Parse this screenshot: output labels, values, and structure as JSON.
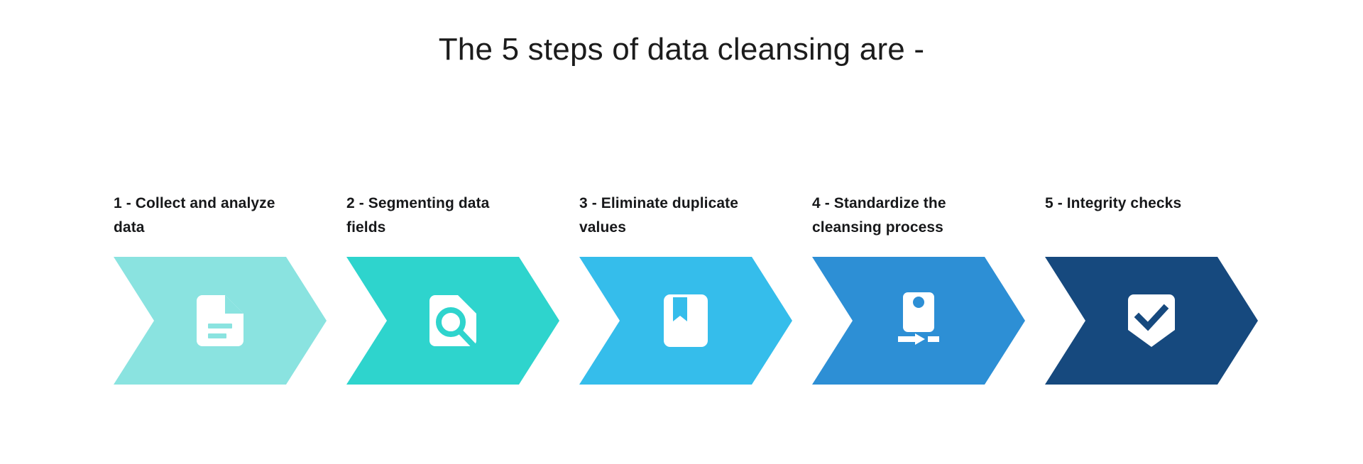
{
  "header": {
    "title": "The 5 steps of data cleansing are -"
  },
  "colors": {
    "background": "#ffffff",
    "title_text": "#1c1c1c",
    "label_text": "#17181a",
    "icon_fill": "#ffffff",
    "step1": "#8ae3e0",
    "step2": "#2ed4cd",
    "step3": "#35bdeb",
    "step4": "#2d8fd5",
    "step5": "#16497e"
  },
  "steps": [
    {
      "number": "1",
      "label": "1 - Collect and analyze data",
      "color": "#8ae3e0",
      "icon": "document-icon"
    },
    {
      "number": "2",
      "label": "2 - Segmenting data fields",
      "color": "#2ed4cd",
      "icon": "document-search-icon"
    },
    {
      "number": "3",
      "label": "3 - Eliminate duplicate values",
      "color": "#35bdeb",
      "icon": "bookmark-icon"
    },
    {
      "number": "4",
      "label": "4 - Standardize the cleansing process",
      "color": "#2d8fd5",
      "icon": "standardize-align-icon"
    },
    {
      "number": "5",
      "label": "5 - Integrity checks",
      "color": "#16497e",
      "icon": "shield-check-icon"
    }
  ]
}
